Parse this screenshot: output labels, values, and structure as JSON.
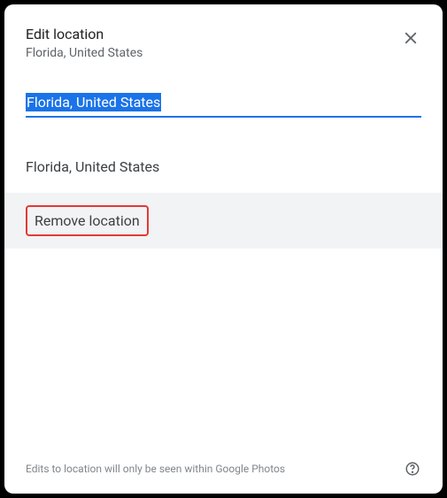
{
  "header": {
    "title": "Edit location",
    "subtitle": "Florida, United States"
  },
  "input": {
    "value": "Florida, United States"
  },
  "suggestions": [
    {
      "label": "Florida, United States"
    }
  ],
  "remove": {
    "label": "Remove location"
  },
  "footer": {
    "note": "Edits to location will only be seen within Google Photos"
  }
}
